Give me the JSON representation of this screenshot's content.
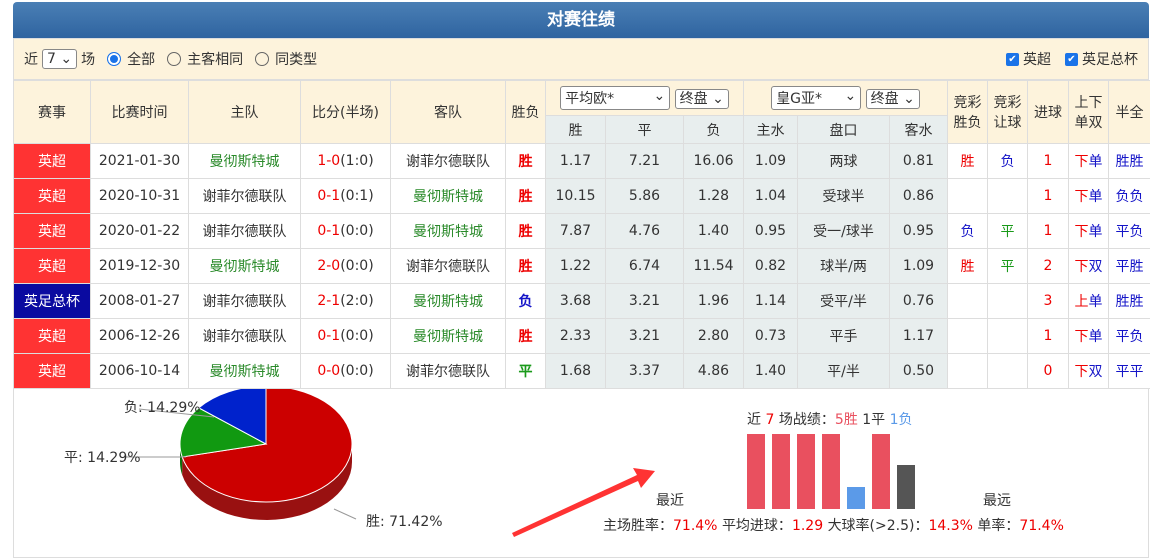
{
  "title": "对赛往绩",
  "filter": {
    "near": "近",
    "count": "7",
    "unit": "场",
    "radios": [
      "全部",
      "主客相同",
      "同类型"
    ],
    "checks": [
      "英超",
      "英足总杯"
    ]
  },
  "headers": {
    "league": "赛事",
    "date": "比赛时间",
    "home": "主队",
    "score": "比分(半场)",
    "away": "客队",
    "result": "胜负",
    "euro_company": "平均欧*",
    "euro_type": "终盘",
    "asia_company": "皇G亚*",
    "asia_type": "终盘",
    "jc_result": "竞彩胜负",
    "jc_handicap": "竞彩让球",
    "goals": "进球",
    "ou": "上下单双",
    "hf": "半全",
    "win": "胜",
    "draw": "平",
    "lose": "负",
    "home_water": "主水",
    "line": "盘口",
    "away_water": "客水"
  },
  "rows": [
    {
      "league": "英超",
      "date": "2021-01-30",
      "home": "曼彻斯特城",
      "ft": "1-0",
      "ht": "(1:0)",
      "away": "谢菲尔德联队",
      "res": "胜",
      "w": "1.17",
      "d": "7.21",
      "l": "16.06",
      "hw": "1.09",
      "line": "两球",
      "aw": "0.81",
      "jcr": "胜",
      "jch": "负",
      "goals": "1",
      "ou1": "下",
      "ou2": "单",
      "hf": "胜胜"
    },
    {
      "league": "英超",
      "date": "2020-10-31",
      "home": "谢菲尔德联队",
      "ft": "0-1",
      "ht": "(0:1)",
      "away": "曼彻斯特城",
      "res": "胜",
      "w": "10.15",
      "d": "5.86",
      "l": "1.28",
      "hw": "1.04",
      "line": "受球半",
      "aw": "0.86",
      "jcr": "",
      "jch": "",
      "goals": "1",
      "ou1": "下",
      "ou2": "单",
      "hf": "负负"
    },
    {
      "league": "英超",
      "date": "2020-01-22",
      "home": "谢菲尔德联队",
      "ft": "0-1",
      "ht": "(0:0)",
      "away": "曼彻斯特城",
      "res": "胜",
      "w": "7.87",
      "d": "4.76",
      "l": "1.40",
      "hw": "0.95",
      "line": "受一/球半",
      "aw": "0.95",
      "jcr": "负",
      "jch": "平",
      "goals": "1",
      "ou1": "下",
      "ou2": "单",
      "hf": "平负"
    },
    {
      "league": "英超",
      "date": "2019-12-30",
      "home": "曼彻斯特城",
      "ft": "2-0",
      "ht": "(0:0)",
      "away": "谢菲尔德联队",
      "res": "胜",
      "w": "1.22",
      "d": "6.74",
      "l": "11.54",
      "hw": "0.82",
      "line": "球半/两",
      "aw": "1.09",
      "jcr": "胜",
      "jch": "平",
      "goals": "2",
      "ou1": "下",
      "ou2": "双",
      "hf": "平胜"
    },
    {
      "league": "英足总杯",
      "date": "2008-01-27",
      "home": "谢菲尔德联队",
      "ft": "2-1",
      "ht": "(2:0)",
      "away": "曼彻斯特城",
      "res": "负",
      "w": "3.68",
      "d": "3.21",
      "l": "1.96",
      "hw": "1.14",
      "line": "受平/半",
      "aw": "0.76",
      "jcr": "",
      "jch": "",
      "goals": "3",
      "ou1": "上",
      "ou2": "单",
      "hf": "胜胜"
    },
    {
      "league": "英超",
      "date": "2006-12-26",
      "home": "谢菲尔德联队",
      "ft": "0-1",
      "ht": "(0:0)",
      "away": "曼彻斯特城",
      "res": "胜",
      "w": "2.33",
      "d": "3.21",
      "l": "2.80",
      "hw": "0.73",
      "line": "平手",
      "aw": "1.17",
      "jcr": "",
      "jch": "",
      "goals": "1",
      "ou1": "下",
      "ou2": "单",
      "hf": "平负"
    },
    {
      "league": "英超",
      "date": "2006-10-14",
      "home": "曼彻斯特城",
      "ft": "0-0",
      "ht": "(0:0)",
      "away": "谢菲尔德联队",
      "res": "平",
      "w": "1.68",
      "d": "3.37",
      "l": "4.86",
      "hw": "1.40",
      "line": "平/半",
      "aw": "0.50",
      "jcr": "",
      "jch": "",
      "goals": "0",
      "ou1": "下",
      "ou2": "双",
      "hf": "平平"
    }
  ],
  "pie": {
    "lose": "负: 14.29%",
    "draw": "平: 14.29%",
    "win": "胜: 71.42%",
    "values": [
      71.42,
      14.29,
      14.29
    ],
    "colors": [
      "#cc0000",
      "#119911",
      "#0022cc"
    ]
  },
  "summary": {
    "pre": "近",
    "n": "7",
    "post": "场战绩：",
    "w": "5胜",
    "d": "1平",
    "l": "1负",
    "recent": "最近",
    "far": "最远",
    "sequence": [
      "胜",
      "胜",
      "胜",
      "胜",
      "负",
      "胜",
      "平"
    ],
    "stats": [
      {
        "k": "主场胜率：",
        "v": "71.4%"
      },
      {
        "k": "平均进球：",
        "v": "1.29"
      },
      {
        "k": "大球率(>2.5)：",
        "v": "14.3%"
      },
      {
        "k": "单率：",
        "v": "71.4%"
      }
    ]
  }
}
